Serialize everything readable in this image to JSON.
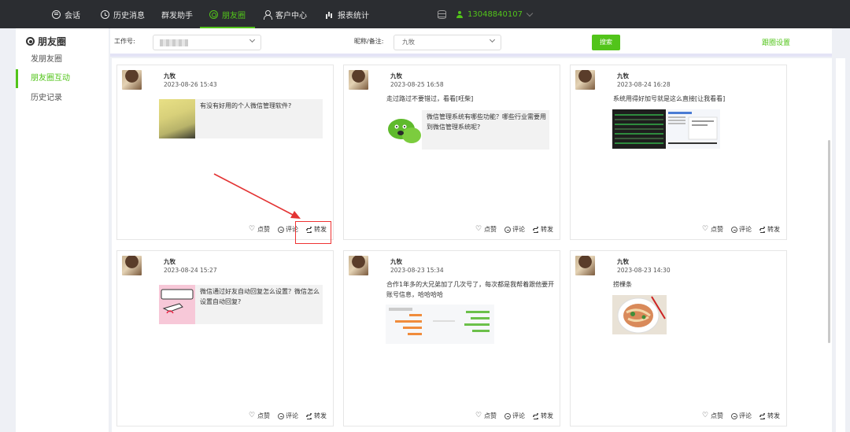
{
  "nav": {
    "items": [
      {
        "label": "会话",
        "icon": "chat-icon"
      },
      {
        "label": "历史消息",
        "icon": "clock-icon"
      },
      {
        "label": "群发助手",
        "icon": ""
      },
      {
        "label": "朋友圈",
        "icon": "moments-icon"
      },
      {
        "label": "客户中心",
        "icon": "user-icon"
      },
      {
        "label": "报表统计",
        "icon": "chart-icon"
      }
    ],
    "active": "朋友圈",
    "account": "13048840107"
  },
  "sidebar": {
    "title": "朋友圈",
    "items": [
      {
        "label": "发朋友圈"
      },
      {
        "label": "朋友圈互动"
      },
      {
        "label": "历史记录"
      }
    ],
    "active": "朋友圈互动"
  },
  "filter": {
    "job_label": "工作号:",
    "nickname_label": "昵称/备注:",
    "nickname_value": "九牧",
    "search_button": "搜索",
    "follow_settings": "跟圈设置"
  },
  "posts": [
    {
      "name": "九牧",
      "time": "2023-08-26 15:43",
      "text": "",
      "share_title": "有没有好用的个人微信管理软件?",
      "like": "点赞",
      "comment": "评论",
      "forward": "转发"
    },
    {
      "name": "九牧",
      "time": "2023-08-25 16:58",
      "text": "走过路过不要错过，看看[旺柴]",
      "share_title": "微信管理系统有哪些功能？哪些行业需要用到微信管理系统呢?",
      "like": "点赞",
      "comment": "评论",
      "forward": "转发"
    },
    {
      "name": "九牧",
      "time": "2023-08-24 16:28",
      "text": "系统用得好加号就是这么直接[让我看看]",
      "share_title": "",
      "like": "点赞",
      "comment": "评论",
      "forward": "转发"
    },
    {
      "name": "九牧",
      "time": "2023-08-24 15:27",
      "text": "",
      "share_title": "微信通过好友自动回复怎么设置？微信怎么设置自动回复?",
      "like": "点赞",
      "comment": "评论",
      "forward": "转发"
    },
    {
      "name": "九牧",
      "time": "2023-08-23 15:34",
      "text": "合作1年多的大兄弟加了几次号了，每次都是我帮着跟他要开账号信息，哈哈哈哈",
      "share_title": "",
      "like": "点赞",
      "comment": "评论",
      "forward": "转发"
    },
    {
      "name": "九牧",
      "time": "2023-08-23 14:30",
      "text": "捞棵条",
      "share_title": "",
      "like": "点赞",
      "comment": "评论",
      "forward": "转发"
    }
  ],
  "colors": {
    "accent": "#52c41a",
    "topbar": "#2b2d31",
    "annotation": "#e33333"
  }
}
